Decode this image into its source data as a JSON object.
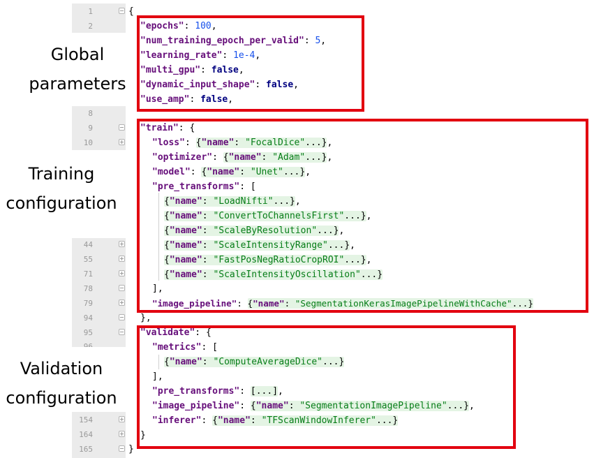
{
  "line_numbers": [
    "1",
    "2",
    "8",
    "9",
    "10",
    "44",
    "55",
    "71",
    "78",
    "79",
    "94",
    "95",
    "96",
    "154",
    "164",
    "165"
  ],
  "labels": {
    "global": [
      "Global",
      "parameters"
    ],
    "training": [
      "Training",
      "configuration"
    ],
    "validation": [
      "Validation",
      "configuration"
    ]
  },
  "code": {
    "open_brace": "{",
    "epochs_key": "\"epochs\"",
    "epochs_val": "100",
    "ntepv_key": "\"num_training_epoch_per_valid\"",
    "ntepv_val": "5",
    "lr_key": "\"learning_rate\"",
    "lr_val": "1e-4",
    "multi_gpu_key": "\"multi_gpu\"",
    "multi_gpu_val": "false",
    "dyn_key": "\"dynamic_input_shape\"",
    "dyn_val": "false",
    "amp_key": "\"use_amp\"",
    "amp_val": "false",
    "train_key": "\"train\"",
    "loss_key": "\"loss\"",
    "loss_val": "\"FocalDice\"",
    "optimizer_key": "\"optimizer\"",
    "optimizer_val": "\"Adam\"",
    "model_key": "\"model\"",
    "model_val": "\"Unet\"",
    "pre_transforms_key": "\"pre_transforms\"",
    "name_key": "\"name\"",
    "t1": "\"LoadNifti\"",
    "t2": "\"ConvertToChannelsFirst\"",
    "t3": "\"ScaleByResolution\"",
    "t4": "\"ScaleIntensityRange\"",
    "t5": "\"FastPosNegRatioCropROI\"",
    "t6": "\"ScaleIntensityOscillation\"",
    "image_pipeline_key": "\"image_pipeline\"",
    "train_pipeline_val": "\"SegmentationKerasImagePipelineWithCache\"",
    "validate_key": "\"validate\"",
    "metrics_key": "\"metrics\"",
    "metric_val": "\"ComputeAverageDice\"",
    "val_pipeline_val": "\"SegmentationImagePipeline\"",
    "inferer_key": "\"inferer\"",
    "inferer_val": "\"TFScanWindowInferer\"",
    "ellipsis": "...",
    "close_brace": "}"
  },
  "colors": {
    "highlight_border": "#e2000f",
    "gutter": "#ebebeb",
    "folded_bg": "#e4f4e4"
  }
}
